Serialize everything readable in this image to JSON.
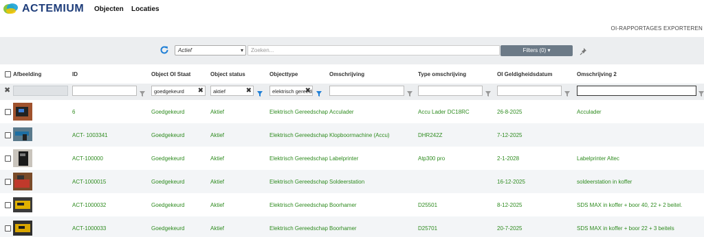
{
  "app": {
    "logo_text": "ACTEMIUM",
    "nav": [
      "Objecten",
      "Locaties"
    ]
  },
  "actions": {
    "export_label": "OI-RAPPORTAGES EXPORTEREN"
  },
  "toolbar": {
    "status_select": "Actief",
    "search_placeholder": "Zoeken...",
    "filters_label": "Filters (0)"
  },
  "columns": [
    "Afbeelding",
    "ID",
    "Object OI Staat",
    "Object status",
    "Objecttype",
    "Omschrijving",
    "Type omschrijving",
    "OI Geldigheidsdatum",
    "Omschrijving 2"
  ],
  "filters": {
    "oi_staat": "goedgekeurd",
    "status": "aktief",
    "objecttype": "elektrisch gereedschap"
  },
  "rows": [
    {
      "id": "6",
      "staat": "Goedgekeurd",
      "status": "Aktief",
      "type": "Elektrisch Gereedschap",
      "omschrijving": "Acculader",
      "type_omschrijving": "Accu Lader DC18RC",
      "datum": "26-8-2025",
      "omschrijving2": "Acculader"
    },
    {
      "id": "ACT- 1003341",
      "staat": "Goedgekeurd",
      "status": "Aktief",
      "type": "Elektrisch Gereedschap",
      "omschrijving": "Klopboormachine (Accu)",
      "type_omschrijving": "DHR242Z",
      "datum": "7-12-2025",
      "omschrijving2": ""
    },
    {
      "id": "ACT-100000",
      "staat": "Goedgekeurd",
      "status": "Aktief",
      "type": "Elektrisch Gereedschap",
      "omschrijving": "Labelprinter",
      "type_omschrijving": "Atp300 pro",
      "datum": "2-1-2028",
      "omschrijving2": "Labelprinter Altec"
    },
    {
      "id": "ACT-1000015",
      "staat": "Goedgekeurd",
      "status": "Aktief",
      "type": "Elektrisch Gereedschap",
      "omschrijving": "Soldeerstation",
      "type_omschrijving": "",
      "datum": "16-12-2025",
      "omschrijving2": "soldeerstation in koffer"
    },
    {
      "id": "ACT-1000032",
      "staat": "Goedgekeurd",
      "status": "Aktief",
      "type": "Elektrisch Gereedschap",
      "omschrijving": "Boorhamer",
      "type_omschrijving": "D25501",
      "datum": "8-12-2025",
      "omschrijving2": "SDS MAX in koffer + boor 40, 22 + 2 beitel."
    },
    {
      "id": "ACT-1000033",
      "staat": "Goedgekeurd",
      "status": "Aktief",
      "type": "Elektrisch Gereedschap",
      "omschrijving": "Boorhamer",
      "type_omschrijving": "D25701",
      "datum": "20-7-2025",
      "omschrijving2": "SDS MAX in koffer + boor 22 + 3 beitels"
    }
  ],
  "colors": {
    "link_green": "#2e8b1f",
    "brand_blue": "#1e3d7a",
    "toolbar_gray": "#eceef0"
  }
}
